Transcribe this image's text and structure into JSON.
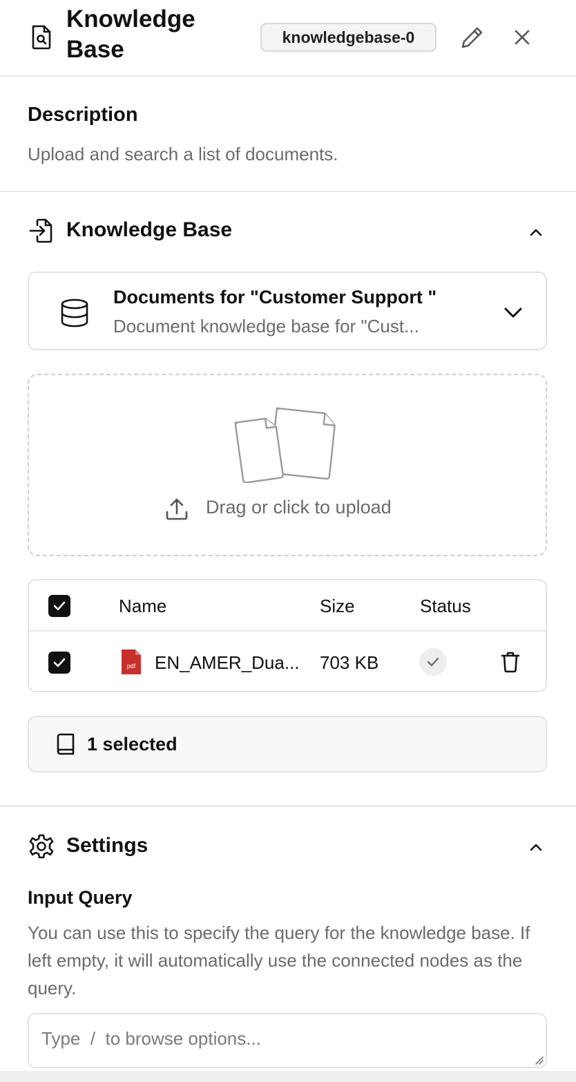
{
  "header": {
    "title": "Knowledge Base",
    "node_id": "knowledgebase-0"
  },
  "description": {
    "title": "Description",
    "text": "Upload and search a list of documents."
  },
  "knowledge_base_section": {
    "title": "Knowledge Base",
    "selector": {
      "name": "Documents for \"Customer Support \"",
      "subtitle": "Document knowledge base for \"Cust..."
    },
    "upload": {
      "label": "Drag or click to upload"
    },
    "table": {
      "columns": [
        "Name",
        "Size",
        "Status"
      ],
      "rows": [
        {
          "name": "EN_AMER_Dua...",
          "size": "703 KB",
          "file_type": "pdf",
          "status": "done"
        }
      ]
    },
    "selected_count_label": "1 selected"
  },
  "settings_section": {
    "title": "Settings",
    "input_query": {
      "label": "Input Query",
      "help": "You can use this to specify the query for the knowledge base. If left empty, it will automatically use the connected nodes as the query.",
      "placeholder": "Type  /  to browse options..."
    }
  },
  "icons": {
    "header": "document-search-icon",
    "edit": "pencil-icon",
    "close": "close-icon",
    "kb_section": "file-import-icon",
    "selector": "database-icon",
    "upload": "upload-icon",
    "file": "pdf-icon",
    "status": "check-icon",
    "delete": "trash-icon",
    "selected": "book-icon",
    "settings": "gear-icon"
  },
  "colors": {
    "pdf": "#c8302c",
    "muted_text": "#6b6b6b",
    "border": "#e2e2e2"
  }
}
